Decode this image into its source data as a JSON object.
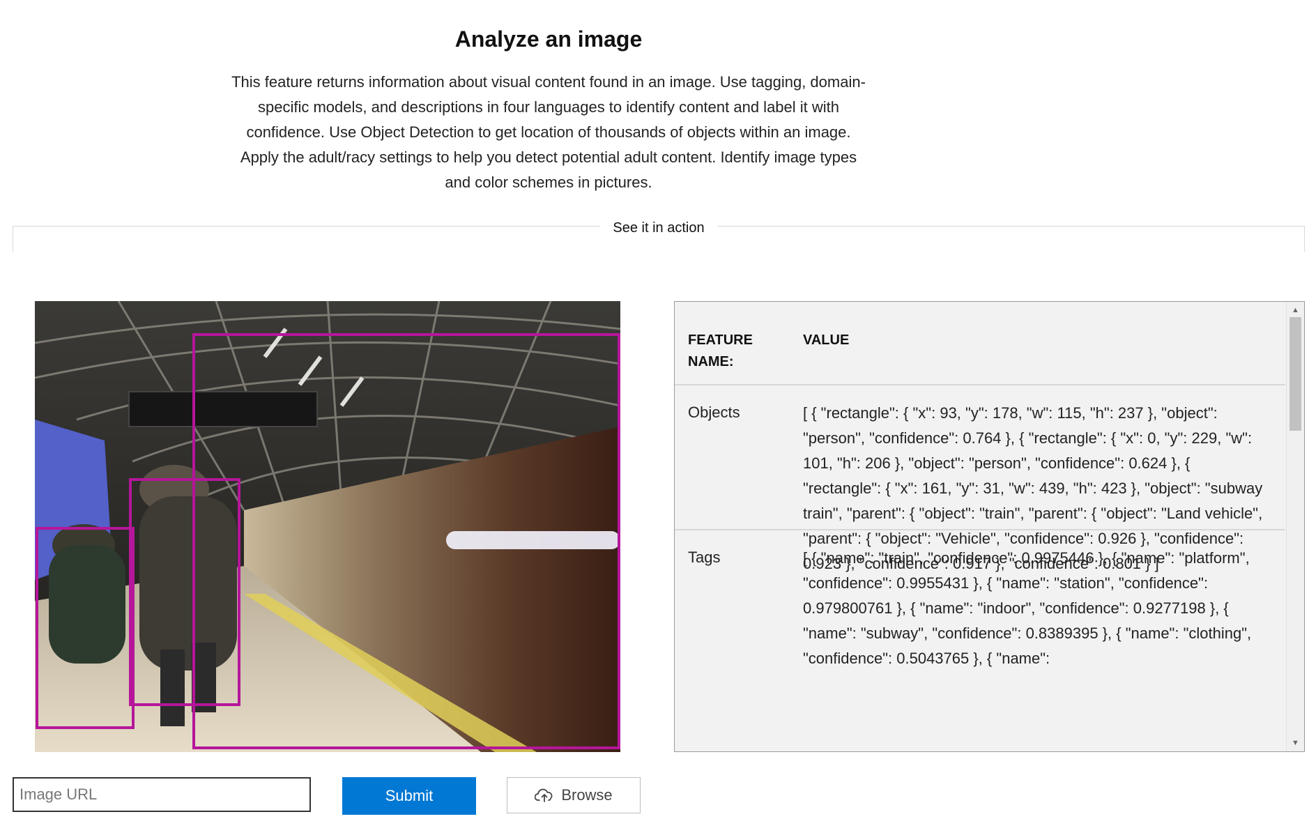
{
  "header": {
    "title": "Analyze an image",
    "description": "This feature returns information about visual content found in an image. Use tagging, domain-specific models, and descriptions in four languages to identify content and label it with confidence. Use Object Detection to get location of thousands of objects within an image. Apply the adult/racy settings to help you detect potential adult content. Identify image types and color schemes in pictures."
  },
  "section": {
    "label": "See it in action"
  },
  "results": {
    "header_name": "FEATURE NAME:",
    "header_value": "VALUE",
    "rows": [
      {
        "name": "Objects",
        "value": "[ { \"rectangle\": { \"x\": 93, \"y\": 178, \"w\": 115, \"h\": 237 }, \"object\": \"person\", \"confidence\": 0.764 }, { \"rectangle\": { \"x\": 0, \"y\": 229, \"w\": 101, \"h\": 206 }, \"object\": \"person\", \"confidence\": 0.624 }, { \"rectangle\": { \"x\": 161, \"y\": 31, \"w\": 439, \"h\": 423 }, \"object\": \"subway train\", \"parent\": { \"object\": \"train\", \"parent\": { \"object\": \"Land vehicle\", \"parent\": { \"object\": \"Vehicle\", \"confidence\": 0.926 }, \"confidence\": 0.923 }, \"confidence\": 0.917 }, \"confidence\": 0.801 } ]"
      },
      {
        "name": "Tags",
        "value": "[ { \"name\": \"train\", \"confidence\": 0.9975446 }, { \"name\": \"platform\", \"confidence\": 0.9955431 }, { \"name\": \"station\", \"confidence\": 0.979800761 }, { \"name\": \"indoor\", \"confidence\": 0.9277198 }, { \"name\": \"subway\", \"confidence\": 0.8389395 }, { \"name\": \"clothing\", \"confidence\": 0.5043765 }, { \"name\":"
      }
    ]
  },
  "controls": {
    "url_placeholder": "Image URL",
    "submit_label": "Submit",
    "browse_label": "Browse"
  },
  "colors": {
    "accent": "#0078d4",
    "box": "#b5169a"
  },
  "icons": {
    "browse": "cloud-upload-icon",
    "scroll_up": "scroll-up-arrow-icon",
    "scroll_down": "scroll-down-arrow-icon"
  }
}
